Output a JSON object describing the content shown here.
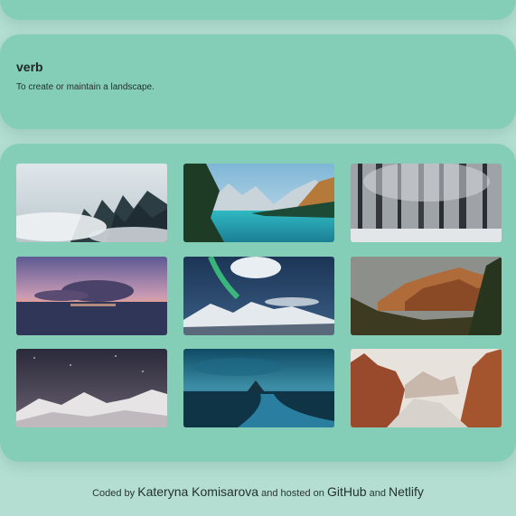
{
  "definition": {
    "word": "verb",
    "meaning": "To create or maintain a landscape."
  },
  "gallery": {
    "photos": [
      {
        "icon": "misty-forest-photo"
      },
      {
        "icon": "mountain-lake-photo"
      },
      {
        "icon": "snowy-forest-photo"
      },
      {
        "icon": "sunset-sea-photo"
      },
      {
        "icon": "aurora-mountains-photo"
      },
      {
        "icon": "canyon-cliffs-photo"
      },
      {
        "icon": "starry-snow-mountains-photo"
      },
      {
        "icon": "island-river-photo"
      },
      {
        "icon": "red-canyon-snow-photo"
      }
    ]
  },
  "footer": {
    "coded_by": "Coded by",
    "author": "Kateryna Komisarova",
    "hosted_on": "and hosted on",
    "github": "GitHub",
    "and": "and",
    "netlify": "Netlify"
  },
  "colors": {
    "background": "#b3ded1",
    "card": "#84cdb6"
  }
}
